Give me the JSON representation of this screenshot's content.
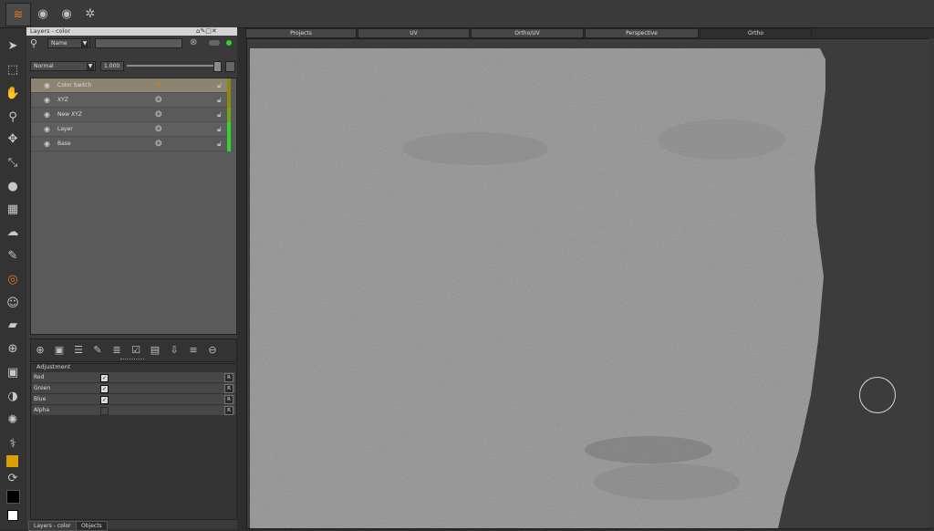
{
  "toolbar_icons": [
    "layers-icon",
    "eye-icon",
    "eye-icon",
    "eye-icon"
  ],
  "left_tools": [
    "select-arrow-icon",
    "marquee-select-icon",
    "hand-icon",
    "zoom-icon",
    "move-icon",
    "transform-icon",
    "drop-icon",
    "grid-icon",
    "smudge-icon",
    "pin-icon",
    "target-icon",
    "face-icon",
    "eraser-icon",
    "stamp-icon",
    "gradient-icon",
    "clone-icon",
    "sparkle-icon",
    "eyedropper-icon",
    "foreground-color-icon",
    "swap-colors-icon",
    "background-color-icon",
    "reset-colors-icon"
  ],
  "colors": {
    "foreground": "#d8a000",
    "background": "#000000",
    "accent": "#e6761a",
    "green": "#2ed62e",
    "olive": "#8a8a12"
  },
  "panel": {
    "title": "Layers - color",
    "filter_mode": "Name",
    "filter_value": "",
    "blend_mode": "Normal",
    "opacity": "1.000",
    "layers": [
      {
        "name": "Color Switch",
        "selected": true
      },
      {
        "name": "XYZ",
        "selected": false
      },
      {
        "name": "New XYZ",
        "selected": false
      },
      {
        "name": "Layer",
        "selected": false
      },
      {
        "name": "Base",
        "selected": false
      }
    ],
    "adjustment": {
      "title": "Adjustment",
      "rows": [
        {
          "label": "Red",
          "checked": true,
          "reset": "R"
        },
        {
          "label": "Green",
          "checked": true,
          "reset": "R"
        },
        {
          "label": "Blue",
          "checked": true,
          "reset": "R"
        },
        {
          "label": "Alpha",
          "checked": false,
          "reset": "R"
        }
      ]
    },
    "bottom_tabs": [
      "Layers - color",
      "Objects"
    ]
  },
  "viewport_tabs": [
    "Projects",
    "UV",
    "Ortho/UV",
    "Perspective",
    "Ortho"
  ],
  "active_viewport_tab": "Ortho"
}
